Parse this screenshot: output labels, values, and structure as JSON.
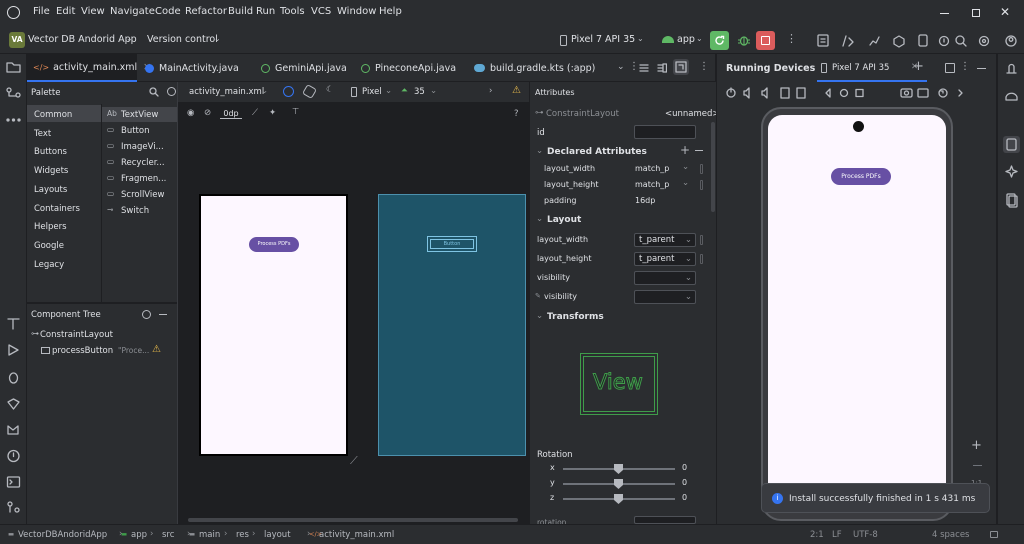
{
  "menu": {
    "items": [
      "File",
      "Edit",
      "View",
      "Navigate",
      "Code",
      "Refactor",
      "Build",
      "Run",
      "Tools",
      "VCS",
      "Window",
      "Help"
    ]
  },
  "toolbar": {
    "project_badge": "VA",
    "project_name": "Vector DB Andorid App",
    "version_control": "Version control",
    "device": "Pixel 7 API 35",
    "run_config": "app"
  },
  "editor_tabs": [
    "activity_main.xml",
    "MainActivity.java",
    "GeminiApi.java",
    "PineconeApi.java",
    "build.gradle.kts (:app)"
  ],
  "running_devices": {
    "title": "Running Devices",
    "tab": "Pixel 7 API 35"
  },
  "palette": {
    "title": "Palette",
    "categories": [
      "Common",
      "Text",
      "Buttons",
      "Widgets",
      "Layouts",
      "Containers",
      "Helpers",
      "Google",
      "Legacy"
    ],
    "widgets": [
      {
        "icon": "Ab",
        "label": "TextView"
      },
      {
        "icon": "btn",
        "label": "Button"
      },
      {
        "icon": "img",
        "label": "ImageVi..."
      },
      {
        "icon": "list",
        "label": "Recycler..."
      },
      {
        "icon": "frag",
        "label": "Fragmen..."
      },
      {
        "icon": "scroll",
        "label": "ScrollView"
      },
      {
        "icon": "switch",
        "label": "Switch"
      }
    ]
  },
  "design_toolbar": {
    "file": "activity_main.xml",
    "device": "Pixel",
    "api": "35",
    "margin": "0dp"
  },
  "component_tree": {
    "title": "Component Tree",
    "root": "ConstraintLayout",
    "child": "processButton",
    "child_hint": "\"Proce..."
  },
  "preview": {
    "button_text": "Process PDFs",
    "blueprint_button_text": "Button"
  },
  "attributes": {
    "title": "Attributes",
    "class": "ConstraintLayout",
    "unnamed": "<unnamed>",
    "id_label": "id",
    "declared_title": "Declared Attributes",
    "declared": [
      {
        "name": "layout_width",
        "value": "match_p"
      },
      {
        "name": "layout_height",
        "value": "match_p"
      },
      {
        "name": "padding",
        "value": "16dp"
      }
    ],
    "layout_title": "Layout",
    "layout_rows": [
      {
        "name": "layout_width",
        "value": "t_parent"
      },
      {
        "name": "layout_height",
        "value": "t_parent"
      },
      {
        "name": "visibility",
        "value": ""
      },
      {
        "name": "visibility",
        "value": ""
      }
    ],
    "transforms_title": "Transforms",
    "view_label": "View",
    "rotation_title": "Rotation",
    "rotation": [
      {
        "axis": "x",
        "value": "0"
      },
      {
        "axis": "y",
        "value": "0"
      },
      {
        "axis": "z",
        "value": "0"
      }
    ],
    "rotation_cut": "rotation"
  },
  "emulator": {
    "button_text": "Process PDFs",
    "zoom_ratio": "1:1"
  },
  "notification": {
    "text": "Install successfully finished in 1 s 431 ms"
  },
  "status": {
    "breadcrumb": [
      "VectorDBAndoridApp",
      "app",
      "src",
      "main",
      "res",
      "layout",
      "activity_main.xml"
    ],
    "position": "2:1",
    "line_sep": "LF",
    "encoding": "UTF-8",
    "indent": "4 spaces"
  },
  "colors": {
    "accent_purple": "#6750a4",
    "blueprint": "#1e5468",
    "run_green": "#5fb865",
    "stop_red": "#db5c5c"
  }
}
